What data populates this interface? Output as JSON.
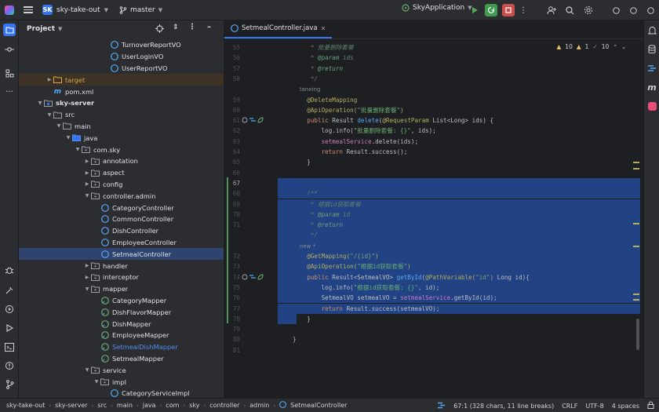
{
  "titlebar": {
    "project_badge": "SK",
    "project_name": "sky-take-out",
    "branch": "master",
    "run_config": "SkyApplication"
  },
  "project_panel": {
    "title": "Project",
    "tree": [
      {
        "label": "TurnoverReportVO",
        "depth": 8,
        "kind": "class",
        "arrow": ""
      },
      {
        "label": "UserLoginVO",
        "depth": 8,
        "kind": "class",
        "arrow": ""
      },
      {
        "label": "UserReportVO",
        "depth": 8,
        "kind": "class",
        "arrow": ""
      },
      {
        "label": "target",
        "depth": 2,
        "kind": "folder-target",
        "arrow": ">"
      },
      {
        "label": "pom.xml",
        "depth": 2,
        "kind": "maven",
        "arrow": ""
      },
      {
        "label": "sky-server",
        "depth": 1,
        "kind": "module",
        "arrow": "v"
      },
      {
        "label": "src",
        "depth": 2,
        "kind": "folder",
        "arrow": "v"
      },
      {
        "label": "main",
        "depth": 3,
        "kind": "folder",
        "arrow": "v"
      },
      {
        "label": "java",
        "depth": 4,
        "kind": "folder-src",
        "arrow": "v"
      },
      {
        "label": "com.sky",
        "depth": 5,
        "kind": "package",
        "arrow": "v"
      },
      {
        "label": "annotation",
        "depth": 6,
        "kind": "package",
        "arrow": ">"
      },
      {
        "label": "aspect",
        "depth": 6,
        "kind": "package",
        "arrow": ">"
      },
      {
        "label": "config",
        "depth": 6,
        "kind": "package",
        "arrow": ">"
      },
      {
        "label": "controller.admin",
        "depth": 6,
        "kind": "package",
        "arrow": "v"
      },
      {
        "label": "CategoryController",
        "depth": 7,
        "kind": "class",
        "arrow": ""
      },
      {
        "label": "CommonController",
        "depth": 7,
        "kind": "class",
        "arrow": ""
      },
      {
        "label": "DishController",
        "depth": 7,
        "kind": "class",
        "arrow": ""
      },
      {
        "label": "EmployeeController",
        "depth": 7,
        "kind": "class",
        "arrow": ""
      },
      {
        "label": "SetmealController",
        "depth": 7,
        "kind": "class",
        "arrow": "",
        "selected": true
      },
      {
        "label": "handler",
        "depth": 6,
        "kind": "package",
        "arrow": ">"
      },
      {
        "label": "interceptor",
        "depth": 6,
        "kind": "package",
        "arrow": ">"
      },
      {
        "label": "mapper",
        "depth": 6,
        "kind": "package",
        "arrow": "v"
      },
      {
        "label": "CategoryMapper",
        "depth": 7,
        "kind": "interface",
        "arrow": ""
      },
      {
        "label": "DishFlavorMapper",
        "depth": 7,
        "kind": "interface",
        "arrow": ""
      },
      {
        "label": "DishMapper",
        "depth": 7,
        "kind": "interface",
        "arrow": ""
      },
      {
        "label": "EmployeeMapper",
        "depth": 7,
        "kind": "interface",
        "arrow": ""
      },
      {
        "label": "SetmealDishMapper",
        "depth": 7,
        "kind": "interface",
        "arrow": "",
        "blue": true
      },
      {
        "label": "SetmealMapper",
        "depth": 7,
        "kind": "interface",
        "arrow": ""
      },
      {
        "label": "service",
        "depth": 6,
        "kind": "package",
        "arrow": "v"
      },
      {
        "label": "impl",
        "depth": 7,
        "kind": "package",
        "arrow": "v"
      },
      {
        "label": "CategoryServiceImpl",
        "depth": 8,
        "kind": "class",
        "arrow": ""
      }
    ]
  },
  "editor": {
    "tab_label": "SetmealController.java",
    "inspections": {
      "warnings": "10",
      "weak": "1",
      "typos": "10"
    },
    "author_hint": "tanxing",
    "new_hint": "new *",
    "lines": [
      {
        "n": "55",
        "segs": [
          [
            "c-com",
            "     * "
          ],
          [
            "c-com",
            "批量删除套餐"
          ]
        ]
      },
      {
        "n": "56",
        "segs": [
          [
            "c-com",
            "     * "
          ],
          [
            "c-tag",
            "@param"
          ],
          [
            "c-com",
            " ids"
          ]
        ]
      },
      {
        "n": "57",
        "segs": [
          [
            "c-com",
            "     * "
          ],
          [
            "c-tag",
            "@return"
          ]
        ]
      },
      {
        "n": "58",
        "segs": [
          [
            "c-com",
            "     */"
          ]
        ]
      },
      {
        "n": "",
        "hint": "author"
      },
      {
        "n": "59",
        "segs": [
          [
            "c-ann",
            "    @DeleteMapping"
          ]
        ]
      },
      {
        "n": "60",
        "segs": [
          [
            "c-ann",
            "    @ApiOperation("
          ],
          [
            "c-str",
            "\"批量删除套餐\""
          ],
          [
            "c-ann",
            ")"
          ]
        ]
      },
      {
        "n": "61",
        "icons": true,
        "segs": [
          [
            "c-kw",
            "    public "
          ],
          [
            "c-def",
            "Result "
          ],
          [
            "c-fn",
            "delete"
          ],
          [
            "c-def",
            "("
          ],
          [
            "c-ann",
            "@RequestParam "
          ],
          [
            "c-def",
            "List<Long> ids) {"
          ]
        ]
      },
      {
        "n": "62",
        "segs": [
          [
            "c-def",
            "        log."
          ],
          [
            "c-def",
            "info("
          ],
          [
            "c-str",
            "\"批量删除套餐: {}\""
          ],
          [
            "c-def",
            ", ids);"
          ]
        ]
      },
      {
        "n": "63",
        "segs": [
          [
            "c-fld",
            "        setmealService"
          ],
          [
            "c-def",
            ".delete(ids);"
          ]
        ]
      },
      {
        "n": "64",
        "segs": [
          [
            "c-kw",
            "        return "
          ],
          [
            "c-def",
            "Result.success();"
          ]
        ]
      },
      {
        "n": "65",
        "segs": [
          [
            "c-def",
            "    }"
          ]
        ]
      },
      {
        "n": "66",
        "segs": []
      },
      {
        "n": "67",
        "sel": true,
        "segs": []
      },
      {
        "n": "68",
        "sel": true,
        "segs": [
          [
            "c-com",
            "    /**"
          ]
        ]
      },
      {
        "n": "69",
        "sel": true,
        "segs": [
          [
            "c-com",
            "     * "
          ],
          [
            "c-com",
            "根据id获取套餐"
          ]
        ]
      },
      {
        "n": "70",
        "sel": true,
        "segs": [
          [
            "c-com",
            "     * "
          ],
          [
            "c-tag",
            "@param"
          ],
          [
            "c-com",
            " id"
          ]
        ]
      },
      {
        "n": "71",
        "sel": true,
        "segs": [
          [
            "c-com",
            "     * "
          ],
          [
            "c-tag",
            "@return"
          ]
        ]
      },
      {
        "n": "",
        "sel": true,
        "segs": [
          [
            "c-com",
            "     */"
          ]
        ]
      },
      {
        "n": "",
        "sel": true,
        "hint": "new"
      },
      {
        "n": "72",
        "sel": true,
        "segs": [
          [
            "c-ann",
            "    @GetMapping("
          ],
          [
            "c-str",
            "\"/{id}\""
          ],
          [
            "c-ann",
            ")"
          ]
        ]
      },
      {
        "n": "73",
        "sel": true,
        "segs": [
          [
            "c-ann",
            "    @ApiOperation("
          ],
          [
            "c-str",
            "\"根据id获取套餐\""
          ],
          [
            "c-ann",
            ")"
          ]
        ]
      },
      {
        "n": "74",
        "sel": true,
        "icons": true,
        "segs": [
          [
            "c-kw",
            "    public "
          ],
          [
            "c-def",
            "Result<SetmealVO> "
          ],
          [
            "c-fn",
            "getById"
          ],
          [
            "c-def",
            "("
          ],
          [
            "c-ann",
            "@PathVariable("
          ],
          [
            "c-str",
            "\"id\""
          ],
          [
            "c-ann",
            ") "
          ],
          [
            "c-def",
            "Long id){"
          ]
        ]
      },
      {
        "n": "75",
        "sel": true,
        "segs": [
          [
            "c-def",
            "        log.info("
          ],
          [
            "c-str",
            "\"根据id获取套餐: {}\""
          ],
          [
            "c-def",
            ", id);"
          ]
        ]
      },
      {
        "n": "76",
        "sel": true,
        "segs": [
          [
            "c-def",
            "        SetmealVO setmealVO = "
          ],
          [
            "c-fld",
            "setmealService"
          ],
          [
            "c-def",
            ".getById(id);"
          ]
        ]
      },
      {
        "n": "77",
        "sel": true,
        "segs": [
          [
            "c-kw",
            "        return "
          ],
          [
            "c-def",
            "Result.success(setmealVO);"
          ]
        ]
      },
      {
        "n": "78",
        "sel": true,
        "partial": true,
        "segs": [
          [
            "c-def",
            "    }"
          ]
        ]
      },
      {
        "n": "79",
        "segs": []
      },
      {
        "n": "80",
        "segs": [
          [
            "c-def",
            "}"
          ]
        ]
      },
      {
        "n": "81",
        "segs": []
      }
    ]
  },
  "statusbar": {
    "crumbs": [
      "sky-take-out",
      "sky-server",
      "src",
      "main",
      "java",
      "com",
      "sky",
      "controller",
      "admin",
      "SetmealController"
    ],
    "position": "67:1 (328 chars, 11 line breaks)",
    "line_sep": "CRLF",
    "encoding": "UTF-8",
    "indent": "4 spaces"
  }
}
